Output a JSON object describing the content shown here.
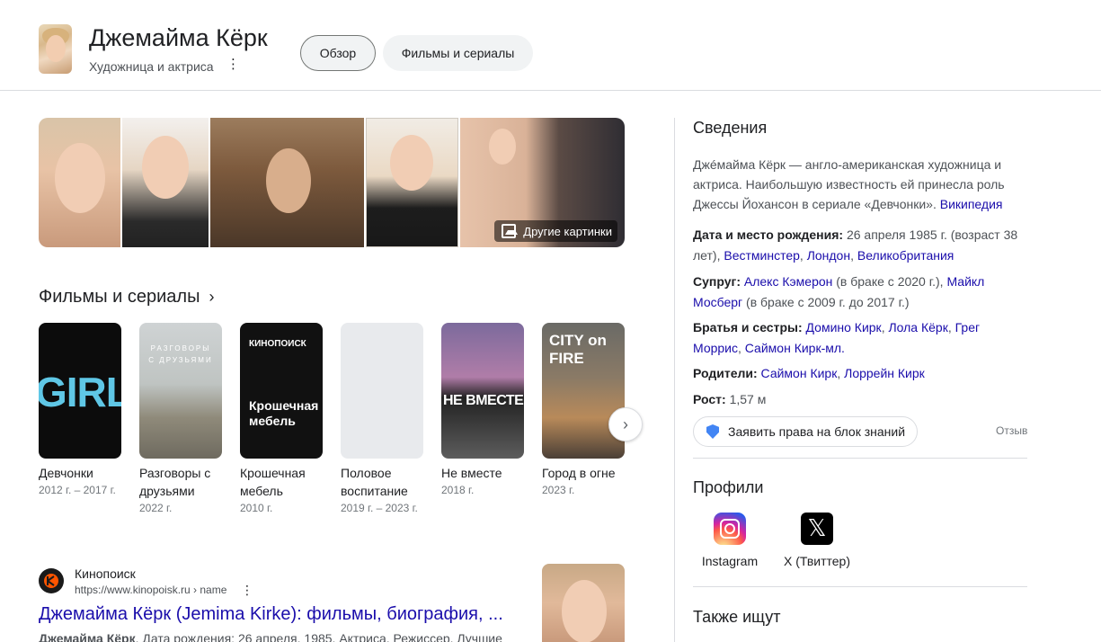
{
  "header": {
    "title": "Джемайма Кёрк",
    "subtitle": "Художница и актриса",
    "more_glyph": "⋮",
    "tabs": [
      {
        "label": "Обзор",
        "active": true
      },
      {
        "label": "Фильмы и сериалы",
        "active": false
      }
    ]
  },
  "images": {
    "more_label": "Другие картинки",
    "more_icon": "image-icon"
  },
  "films": {
    "heading": "Фильмы и сериалы",
    "heading_icon": "chevron-right-icon",
    "next_icon": "chevron-right-icon",
    "next_glyph": "›",
    "items": [
      {
        "title": "Девчонки",
        "year": "2012 г. – 2017 г.",
        "poster_text": "GIRLS"
      },
      {
        "title": "Разговоры с друзьями",
        "year": "2022 г.",
        "poster_text": "РАЗГОВОРЫ С ДРУЗЬЯМИ"
      },
      {
        "title": "Крошечная мебель",
        "year": "2010 г.",
        "poster_text": "Крошечная мебель",
        "poster_brand": "КИНОПОИСК"
      },
      {
        "title": "Половое воспитание",
        "year": "2019 г. – 2023 г.",
        "poster_text": ""
      },
      {
        "title": "Не вместе",
        "year": "2018 г.",
        "poster_text": "НЕ ВМЕСТЕ"
      },
      {
        "title": "Город в огне",
        "year": "2023 г.",
        "poster_text": "CITY on FIRE"
      }
    ]
  },
  "result": {
    "site": "Кинопоиск",
    "url": "https://www.kinopoisk.ru › name",
    "title": "Джемайма Кёрк (Jemima Kirke): фильмы, биография, ...",
    "snippet_bold": "Джемайма Кёрк",
    "snippet": ". Дата рождения: 26 апреля, 1985. Актриса, Режиссер. Лучшие"
  },
  "knowledge": {
    "title": "Сведения",
    "description": "Джéмайма Кёрк — англо-американская художница и актриса. Наибольшую известность ей принесла роль Джессы Йохансон в сериале «Девчонки».",
    "source_link": "Википедия",
    "birth_label": "Дата и место рождения:",
    "birth_text": "26 апреля 1985 г. (возраст 38 лет),",
    "birth_places": [
      "Вестминстер",
      "Лондон",
      "Великобритания"
    ],
    "spouse_label": "Супруг:",
    "spouse_1": "Алекс Кэмерон",
    "spouse_1_note": "(в браке с 2020 г.),",
    "spouse_2": "Майкл Мосберг",
    "spouse_2_note": "(в браке с 2009 г. до 2017 г.)",
    "siblings_label": "Братья и сестры:",
    "siblings": [
      "Домино Кирк",
      "Лола Кёрк",
      "Грег Моррис",
      "Саймон Кирк-мл."
    ],
    "parents_label": "Родители:",
    "parents": [
      "Саймон Кирк",
      "Лоррейн Кирк"
    ],
    "height_label": "Рост:",
    "height_value": "1,57 м",
    "claim_label": "Заявить права на блок знаний",
    "feedback_label": "Отзыв",
    "profiles_title": "Профили",
    "profiles": [
      {
        "label": "Instagram",
        "icon": "instagram-icon"
      },
      {
        "label": "X (Твиттер)",
        "icon": "x-icon",
        "glyph": "𝕏"
      }
    ],
    "also_title": "Также ищут"
  }
}
